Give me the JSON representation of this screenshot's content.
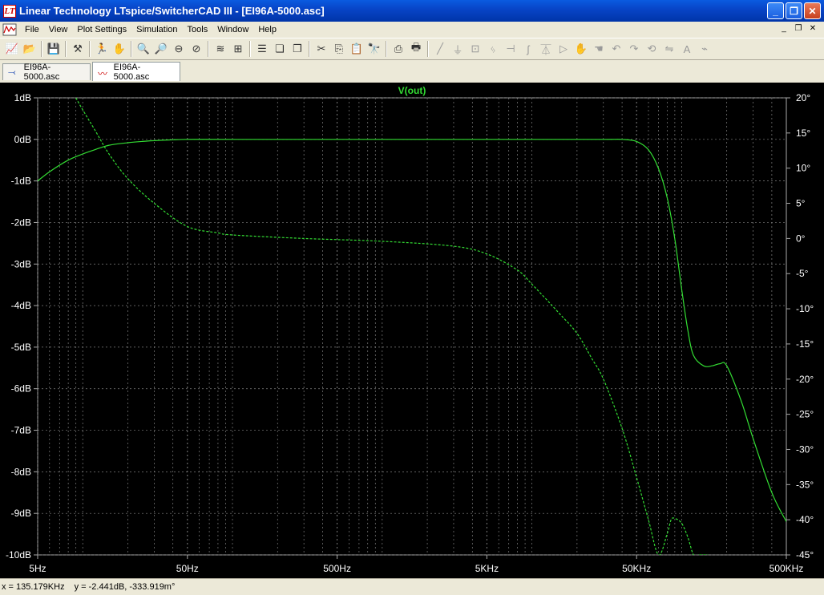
{
  "window": {
    "title": "Linear Technology LTspice/SwitcherCAD III - [EI96A-5000.asc]",
    "app_icon": "ltspice-logo-icon",
    "minimize": "_",
    "maximize": "❐",
    "close": "✕"
  },
  "menu": {
    "items": [
      "File",
      "View",
      "Plot Settings",
      "Simulation",
      "Tools",
      "Window",
      "Help"
    ],
    "mdi_minimize": "_",
    "mdi_restore": "❐",
    "mdi_close": "✕"
  },
  "toolbar": {
    "icons": [
      "new-schematic-icon",
      "open-icon",
      "save-icon",
      "control-panel-icon",
      "run-icon",
      "halt-icon",
      "zoom-in-icon",
      "zoom-area-icon",
      "zoom-out-icon",
      "zoom-cancel-icon",
      "autorange-icon",
      "mark-icon",
      "tile-horizontal-icon",
      "cascade-icon",
      "tile-vertical-icon",
      "cut-icon",
      "copy-icon",
      "paste-icon",
      "find-icon",
      "print-preview-icon",
      "print-icon",
      "wire-icon",
      "ground-icon",
      "label-icon",
      "resistor-icon",
      "capacitor-icon",
      "inductor-icon",
      "diode-icon",
      "component-icon",
      "move-icon",
      "drag-icon",
      "undo-icon",
      "redo-icon",
      "rotate-icon",
      "mirror-icon",
      "text-icon",
      "spice-directive-icon"
    ]
  },
  "tabs": [
    {
      "label": "EI96A-5000.asc",
      "icon": "schematic-icon",
      "active": false
    },
    {
      "label": "EI96A-5000.asc",
      "icon": "waveform-icon",
      "active": true
    }
  ],
  "plot": {
    "trace_label": "V(out)",
    "trace_color": "#33dd33",
    "grid_color": "#808080",
    "background": "#000000",
    "left_ticks": [
      "1dB",
      "0dB",
      "-1dB",
      "-2dB",
      "-3dB",
      "-4dB",
      "-5dB",
      "-6dB",
      "-7dB",
      "-8dB",
      "-9dB",
      "-10dB"
    ],
    "right_ticks": [
      "20°",
      "15°",
      "10°",
      "5°",
      "0°",
      "-5°",
      "-10°",
      "-15°",
      "-20°",
      "-25°",
      "-30°",
      "-35°",
      "-40°",
      "-45°"
    ],
    "x_ticks": [
      "5Hz",
      "50Hz",
      "500Hz",
      "5KHz",
      "50KHz",
      "500KHz"
    ]
  },
  "chart_data": {
    "type": "line",
    "title": "V(out)",
    "x_scale": "log",
    "xlim": [
      5,
      500000
    ],
    "ylim_left": [
      -10,
      1
    ],
    "ylim_right": [
      -45,
      20
    ],
    "series": [
      {
        "name": "V(out)",
        "axis": "left",
        "style": "solid",
        "x": [
          5,
          6,
          8,
          10,
          12,
          15,
          20,
          25,
          30,
          40,
          50,
          100,
          1000,
          10000,
          30000,
          40000,
          50000,
          60000,
          70000,
          80000,
          90000,
          100000,
          110000,
          120000,
          140000,
          160000,
          180000,
          200000,
          250000,
          300000,
          400000,
          500000
        ],
        "y": [
          -1.0,
          -0.78,
          -0.5,
          -0.35,
          -0.25,
          -0.14,
          -0.08,
          -0.05,
          -0.03,
          -0.01,
          0,
          0,
          0,
          0,
          0,
          0,
          -0.05,
          -0.25,
          -0.7,
          -1.4,
          -2.4,
          -3.6,
          -4.6,
          -5.2,
          -5.45,
          -5.45,
          -5.4,
          -5.45,
          -6.3,
          -7.2,
          -8.5,
          -9.2
        ]
      },
      {
        "name": "phase",
        "axis": "right",
        "style": "dashed",
        "x": [
          9,
          10,
          12,
          15,
          20,
          30,
          50,
          80,
          100,
          300,
          1000,
          3000,
          5000,
          8000,
          10000,
          15000,
          20000,
          25000,
          30000,
          40000,
          50000,
          60000,
          70000,
          80000,
          85000,
          90000,
          100000,
          110000,
          120000,
          130000,
          150000
        ],
        "y": [
          20,
          18.3,
          15.5,
          12,
          8.5,
          5,
          1.7,
          0.8,
          0.5,
          0,
          -0.4,
          -1.1,
          -2.2,
          -4.5,
          -6.5,
          -10.5,
          -13.5,
          -17,
          -20,
          -27,
          -34,
          -40,
          -45,
          -42,
          -40,
          -39.8,
          -40.5,
          -42.5,
          -45,
          -45,
          -45
        ]
      }
    ]
  },
  "status": {
    "cursor_x": "x = 135.179KHz",
    "cursor_y": "y = -2.441dB, -333.919m°"
  }
}
